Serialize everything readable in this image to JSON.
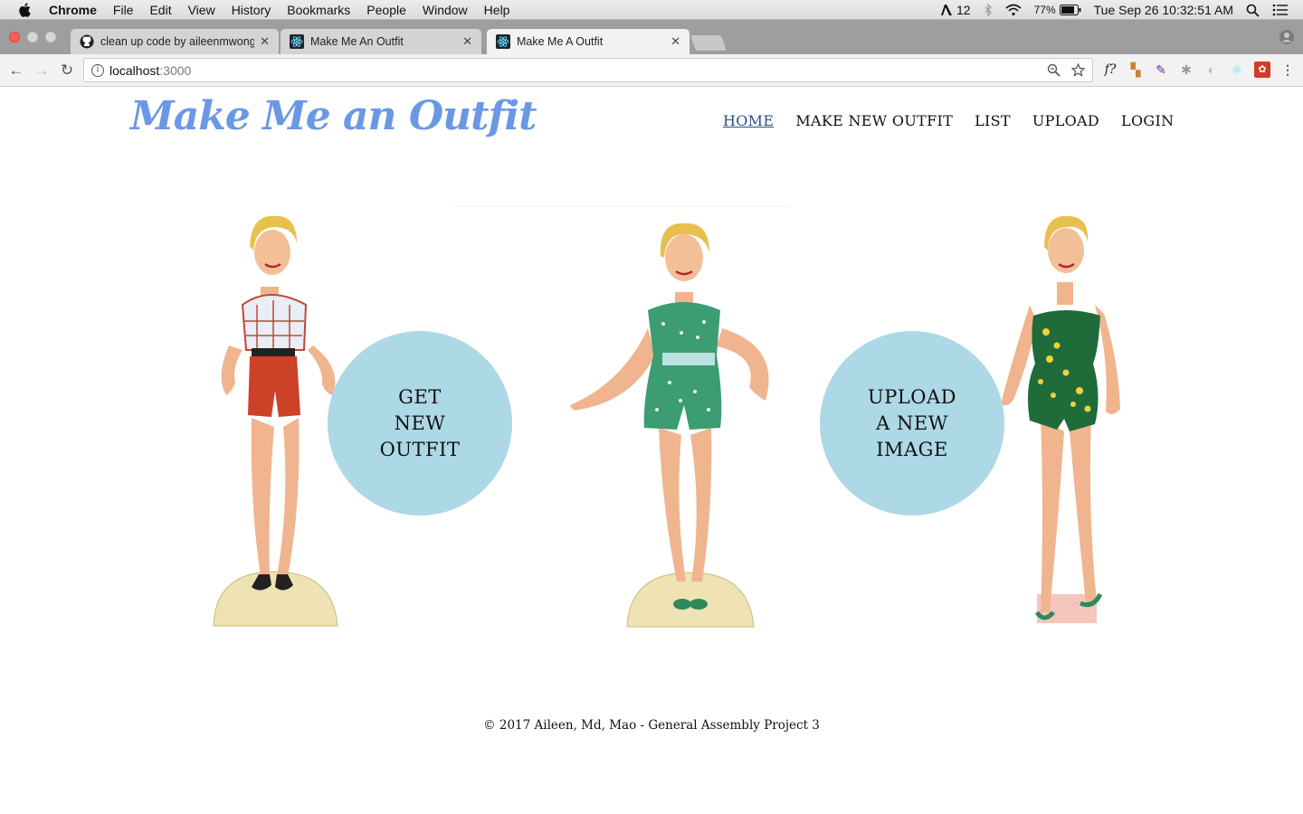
{
  "menubar": {
    "app_name": "Chrome",
    "menus": [
      "File",
      "Edit",
      "View",
      "History",
      "Bookmarks",
      "People",
      "Window",
      "Help"
    ],
    "adobe_count": "12",
    "battery": "77%",
    "datetime": "Tue Sep 26  10:32:51 AM"
  },
  "tabs": [
    {
      "title": "clean up code by aileenmwong",
      "icon": "github-icon"
    },
    {
      "title": "Make Me An Outfit",
      "icon": "react-icon"
    },
    {
      "title": "Make Me A Outfit",
      "icon": "react-icon",
      "active": true
    }
  ],
  "toolbar": {
    "url_host": "localhost",
    "url_port": ":3000",
    "font_ext_label": "f?"
  },
  "site": {
    "logo": "Make Me an Outfit",
    "nav": [
      "HOME",
      "MAKE NEW OUTFIT",
      "LIST",
      "UPLOAD",
      "LOGIN"
    ],
    "get_outfit_button": [
      "GET",
      "NEW",
      "OUTFIT"
    ],
    "upload_button": [
      "UPLOAD",
      "A NEW",
      "IMAGE"
    ],
    "footer": "© 2017 Aileen, Md, Mao - General Assembly Project 3"
  },
  "colors": {
    "logo": "#6a98e4",
    "circle": "#add8e6",
    "nav_active": "#2d4f8a"
  }
}
